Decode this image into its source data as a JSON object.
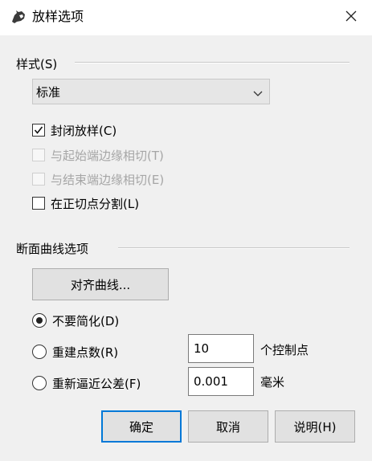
{
  "window": {
    "title": "放样选项",
    "close_glyph": "✕"
  },
  "style_group": {
    "label": "样式(S)",
    "selected": "标准"
  },
  "checkboxes": [
    {
      "label": "封闭放样(C)",
      "checked": true,
      "enabled": true
    },
    {
      "label": "与起始端边缘相切(T)",
      "checked": false,
      "enabled": false
    },
    {
      "label": "与结束端边缘相切(E)",
      "checked": false,
      "enabled": false
    },
    {
      "label": "在正切点分割(L)",
      "checked": false,
      "enabled": true
    }
  ],
  "section_group": {
    "label": "断面曲线选项",
    "align_button": "对齐曲线..."
  },
  "radios": [
    {
      "label": "不要简化(D)",
      "selected": true
    },
    {
      "label": "重建点数(R)",
      "selected": false,
      "value": "10",
      "unit": "个控制点"
    },
    {
      "label": "重新逼近公差(F)",
      "selected": false,
      "value": "0.001",
      "unit": "毫米"
    }
  ],
  "buttons": {
    "ok": "确定",
    "cancel": "取消",
    "help": "说明(H)"
  },
  "icons": {
    "app": "rhino-icon",
    "close": "close-icon",
    "dropdown": "chevron-down-icon",
    "check": "check-icon"
  },
  "colors": {
    "focus_border": "#0078d7",
    "disabled_text": "#a6a6a6",
    "background": "#f0f0f0"
  }
}
